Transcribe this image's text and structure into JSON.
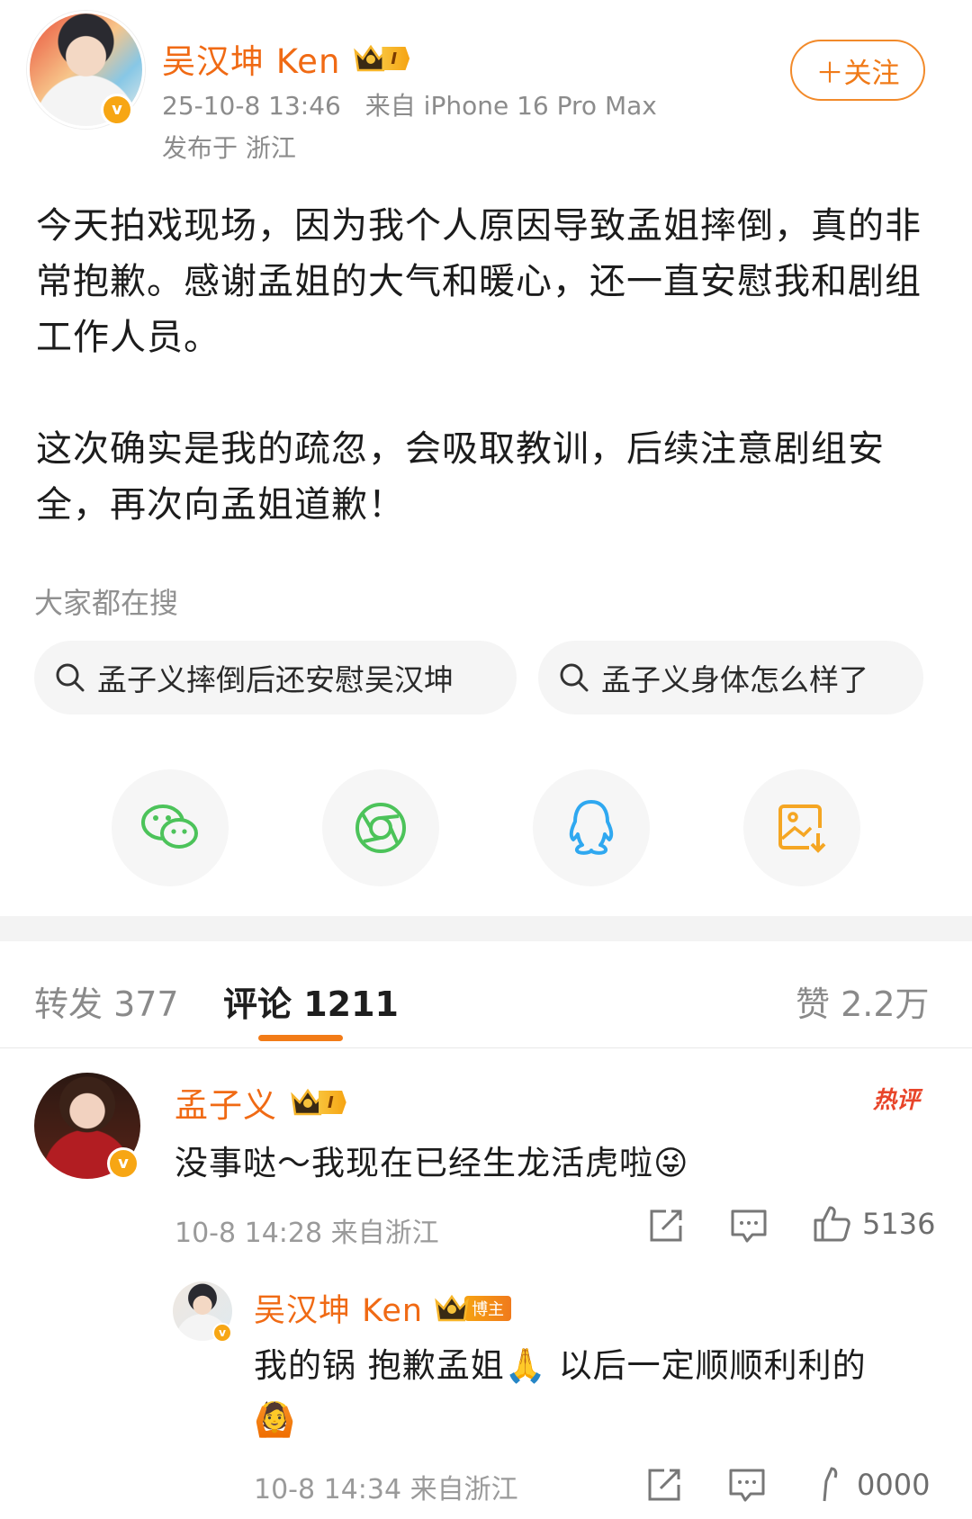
{
  "post": {
    "author": "吴汉坤 Ken",
    "badge_level": "I",
    "time": "25-10-8 13:46",
    "source": "来自 iPhone 16 Pro Max",
    "location": "发布于 浙江",
    "follow_label": "＋关注",
    "paragraph1": "今天拍戏现场，因为我个人原因导致孟姐摔倒，真的非常抱歉。感谢孟姐的大气和暖心，还一直安慰我和剧组工作人员。",
    "paragraph2": "这次确实是我的疏忽，会吸取教训，后续注意剧组安全，再次向孟姐道歉！"
  },
  "search": {
    "title": "大家都在搜",
    "chips": [
      "孟子义摔倒后还安慰吴汉坤",
      "孟子义身体怎么样了"
    ]
  },
  "share": {
    "icons": [
      "wechat-icon",
      "moments-icon",
      "qq-icon",
      "save-image-icon"
    ]
  },
  "tabs": {
    "repost": "转发 377",
    "comment": "评论 1211",
    "like": "赞 2.2万"
  },
  "comments": [
    {
      "author": "孟子义",
      "badge_level": "I",
      "hot_label": "热评",
      "text": "没事哒～我现在已经生龙活虎啦",
      "emoji": "😜",
      "time": "10-8 14:28 来自浙江",
      "likes": "5136"
    },
    {
      "author": "吴汉坤 Ken",
      "host_label": "博主",
      "text": "我的锅 抱歉孟姐🙏 以后一定顺顺利利的",
      "emoji": "🙆",
      "time": "10-8 14:34 来自浙江",
      "likes": "0000"
    }
  ],
  "colors": {
    "accent": "#f06a14",
    "wechat": "#4cc35a",
    "moments": "#4cc35a",
    "qq": "#2fa8f0",
    "save": "#f5a623"
  }
}
